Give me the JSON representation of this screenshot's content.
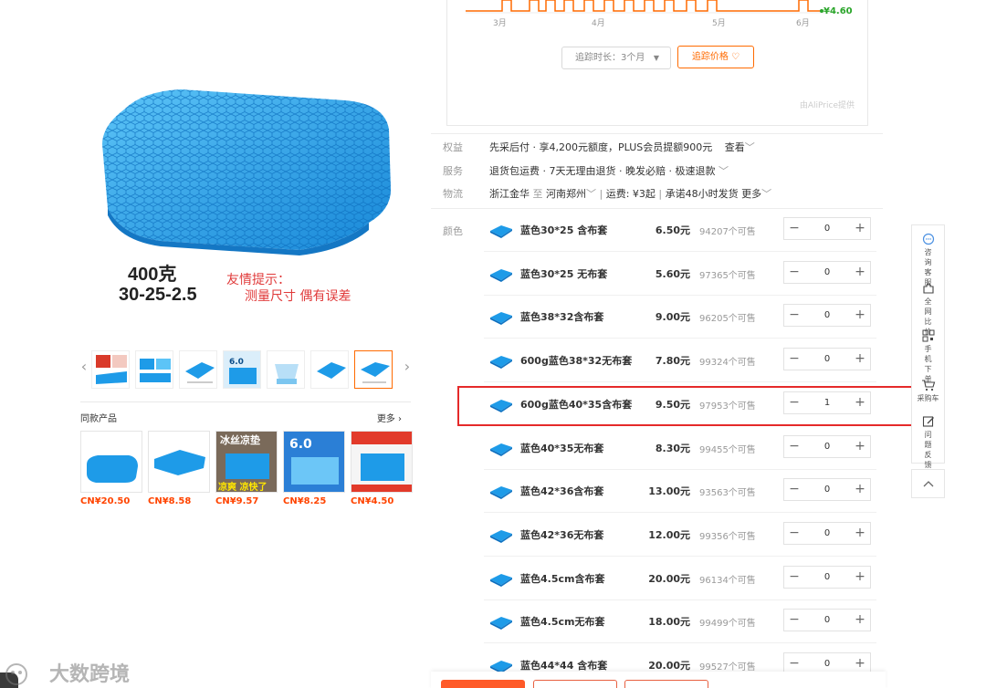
{
  "price_chart": {
    "months": [
      "3月",
      "4月",
      "5月",
      "6月"
    ],
    "last_price": "¥4.60",
    "track_duration_label": "追踪时长：3个月",
    "track_price_button": "追踪价格",
    "source_label": "由AliPrice提供"
  },
  "main_image": {
    "weight_text": "400克",
    "size_text": "30-25-2.5",
    "tip_line1": "友情提示：",
    "tip_line2": "测量尺寸 偶有误差",
    "accent_color": "#1e9be8"
  },
  "thumbnails": {
    "count": 8,
    "active_index": 7
  },
  "similar": {
    "title": "同款产品",
    "more_label": "更多",
    "items": [
      {
        "price": "CN¥20.50"
      },
      {
        "price": "CN¥8.58"
      },
      {
        "price": "CN¥9.57",
        "promo_top": "冰丝凉垫",
        "promo_bottom": "凉爽 凉快了"
      },
      {
        "price": "CN¥8.25",
        "promo_top": "6.0"
      },
      {
        "price": "CN¥4.50"
      }
    ]
  },
  "info": {
    "benefit": {
      "label": "权益",
      "text": "先采后付 · 享4,200元额度，PLUS会员提额900元",
      "link": "查看"
    },
    "service": {
      "label": "服务",
      "text": "退货包运费 · 7天无理由退货 · 晚发必赔 · 极速退款"
    },
    "logistics": {
      "label": "物流",
      "origin": "浙江金华",
      "to": "至",
      "destination": "河南郑州",
      "fee": "运费: ¥3起",
      "promise": "承诺48小时发货",
      "more": "更多"
    }
  },
  "sku": {
    "label": "颜色",
    "rows": [
      {
        "name": "蓝色30*25 含布套",
        "price": "6.50元",
        "stock": "94207个可售",
        "qty": "0"
      },
      {
        "name": "蓝色30*25 无布套",
        "price": "5.60元",
        "stock": "97365个可售",
        "qty": "0"
      },
      {
        "name": "蓝色38*32含布套",
        "price": "9.00元",
        "stock": "96205个可售",
        "qty": "0"
      },
      {
        "name": "600g蓝色38*32无布套",
        "price": "7.80元",
        "stock": "99324个可售",
        "qty": "0"
      },
      {
        "name": "600g蓝色40*35含布套",
        "price": "9.50元",
        "stock": "97953个可售",
        "qty": "1"
      },
      {
        "name": "蓝色40*35无布套",
        "price": "8.30元",
        "stock": "99455个可售",
        "qty": "0"
      },
      {
        "name": "蓝色42*36含布套",
        "price": "13.00元",
        "stock": "93563个可售",
        "qty": "0"
      },
      {
        "name": "蓝色42*36无布套",
        "price": "12.00元",
        "stock": "99356个可售",
        "qty": "0"
      },
      {
        "name": "蓝色4.5cm含布套",
        "price": "20.00元",
        "stock": "96134个可售",
        "qty": "0"
      },
      {
        "name": "蓝色4.5cm无布套",
        "price": "18.00元",
        "stock": "99499个可售",
        "qty": "0"
      },
      {
        "name": "蓝色44*44 含布套",
        "price": "20.00元",
        "stock": "99527个可售",
        "qty": "0"
      }
    ]
  },
  "sidebar": {
    "items": [
      {
        "label": "咨询客服",
        "icon": "chat-bubble-icon"
      },
      {
        "label": "全网比价",
        "icon": "puzzle-icon"
      },
      {
        "label": "手机下单",
        "icon": "qr-code-icon"
      },
      {
        "label": "采购车",
        "icon": "cart-icon"
      },
      {
        "label": "问题反馈",
        "icon": "edit-feedback-icon"
      }
    ],
    "back_to_top_icon": "chevron-up-icon"
  },
  "watermark": {
    "text": "大数跨境"
  },
  "colors": {
    "accent_orange": "#ff6a00",
    "price_red": "#ff4400",
    "highlight_red": "#e52a2a",
    "chart_line": "#ff6a00",
    "chart_last": "#2aa52a"
  }
}
